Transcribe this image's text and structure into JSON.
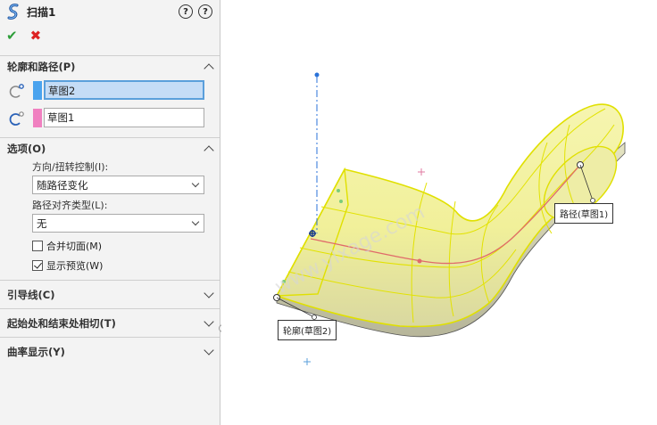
{
  "feature": {
    "title": "扫描1",
    "help_label": "?",
    "help2_label": "?"
  },
  "sections": {
    "profile_path": {
      "title": "轮廓和路径(P)",
      "profile_value": "草图2",
      "path_value": "草图1",
      "profile_color": "#4aa3ee",
      "path_color": "#f080c0"
    },
    "options": {
      "title": "选项(O)",
      "orientation_label": "方向/扭转控制(I):",
      "orientation_value": "随路径变化",
      "alignment_label": "路径对齐类型(L):",
      "alignment_value": "无",
      "merge_label": "合并切面(M)",
      "merge_checked": false,
      "preview_label": "显示预览(W)",
      "preview_checked": true
    },
    "guide_curves": {
      "title": "引导线(C)"
    },
    "tangency": {
      "title": "起始处和结束处相切(T)"
    },
    "curvature": {
      "title": "曲率显示(Y)"
    }
  },
  "viewport": {
    "path_callout": "路径(草图1)",
    "profile_callout": "轮廓(草图2)",
    "watermark": "www.ylxage.com",
    "shape_color": "#f4f3a0",
    "edge_color": "#e2e200"
  }
}
